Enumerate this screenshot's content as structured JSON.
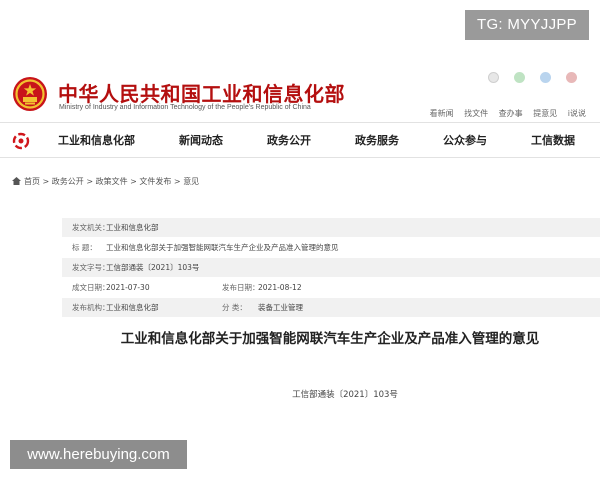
{
  "badge": {
    "text": "TG: MYYJJPP"
  },
  "header": {
    "title": "中华人民共和国工业和信息化部",
    "subtitle": "Ministry of Industry and Information Technology of the People's Republic of China",
    "util_links": [
      "看新闻",
      "找文件",
      "查办事",
      "提意见",
      "i说说"
    ],
    "colors": {
      "brand": "#b40f0f"
    }
  },
  "nav": {
    "items": [
      "工业和信息化部",
      "新闻动态",
      "政务公开",
      "政务服务",
      "公众参与",
      "工信数据"
    ]
  },
  "breadcrumb": {
    "items": [
      "首页",
      "政务公开",
      "政策文件",
      "文件发布",
      "意见"
    ],
    "separator": " > "
  },
  "meta": {
    "issuer_label": "发文机关：",
    "issuer": "工业和信息化部",
    "title_label": "标    题：",
    "title": "工业和信息化部关于加强智能网联汽车生产企业及产品准入管理的意见",
    "number_label": "发文字号：",
    "number": "工信部通装〔2021〕103号",
    "created_label": "成文日期：",
    "created": "2021-07-30",
    "published_label": "发布日期：",
    "published": "2021-08-12",
    "agency_label": "发布机构：",
    "agency": "工业和信息化部",
    "category_label": "分    类：",
    "category": "装备工业管理"
  },
  "document": {
    "title": "工业和信息化部关于加强智能网联汽车生产企业及产品准入管理的意见",
    "number": "工信部通装〔2021〕103号"
  },
  "watermark": {
    "text": "www.herebuying.com"
  }
}
